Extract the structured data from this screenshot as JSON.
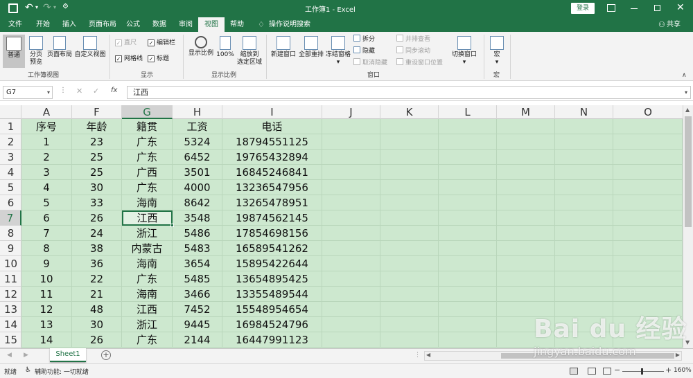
{
  "titlebar": {
    "save_icon": "save-icon",
    "title": "工作簿1  -  Excel",
    "login": "登录"
  },
  "menu": [
    "文件",
    "开始",
    "插入",
    "页面布局",
    "公式",
    "数据",
    "审阅",
    "视图",
    "帮助"
  ],
  "tell_me": "操作说明搜索",
  "share": "共享",
  "ribbon": {
    "views": {
      "normal": "普通",
      "page_break": "分页",
      "page_break2": "预览",
      "page_layout": "页面布局",
      "custom": "自定义视图",
      "group": "工作簿视图"
    },
    "show": {
      "ruler": "直尺",
      "formula_bar": "编辑栏",
      "gridlines": "网格线",
      "headings": "标题",
      "group": "显示"
    },
    "zoom": {
      "zoom": "显示比例",
      "hundred": "100%",
      "to_sel": "缩放到",
      "to_sel2": "选定区域",
      "group": "显示比例"
    },
    "window": {
      "new": "新建窗口",
      "arrange": "全部重排",
      "freeze": "冻结窗格",
      "split": "拆分",
      "hide": "隐藏",
      "unhide": "取消隐藏",
      "side": "并排查看",
      "sync": "同步滚动",
      "reset": "重设窗口位置",
      "switch": "切换窗口",
      "group": "窗口"
    },
    "macros": {
      "label": "宏",
      "group": "宏"
    }
  },
  "formula": {
    "name_box": "G7",
    "fx": "fx",
    "value": "江西"
  },
  "columns": [
    "A",
    "F",
    "G",
    "H",
    "I",
    "J",
    "K",
    "L",
    "M",
    "N",
    "O"
  ],
  "rows": [
    "1",
    "2",
    "3",
    "4",
    "5",
    "6",
    "7",
    "8",
    "9",
    "10",
    "11",
    "12",
    "13",
    "14",
    "15"
  ],
  "table": [
    [
      "序号",
      "年龄",
      "籍贯",
      "工资",
      "电话"
    ],
    [
      "1",
      "23",
      "广东",
      "5324",
      "18794551125"
    ],
    [
      "2",
      "25",
      "广东",
      "6452",
      "19765432894"
    ],
    [
      "3",
      "25",
      "广西",
      "3501",
      "16845246841"
    ],
    [
      "4",
      "30",
      "广东",
      "4000",
      "13236547956"
    ],
    [
      "5",
      "33",
      "海南",
      "8642",
      "13265478951"
    ],
    [
      "6",
      "26",
      "江西",
      "3548",
      "19874562145"
    ],
    [
      "7",
      "24",
      "浙江",
      "5486",
      "17854698156"
    ],
    [
      "8",
      "38",
      "内蒙古",
      "5483",
      "16589541262"
    ],
    [
      "9",
      "36",
      "海南",
      "3654",
      "15895422644"
    ],
    [
      "10",
      "22",
      "广东",
      "5485",
      "13654895425"
    ],
    [
      "11",
      "21",
      "海南",
      "3466",
      "13355489544"
    ],
    [
      "12",
      "48",
      "江西",
      "7452",
      "15548954654"
    ],
    [
      "13",
      "30",
      "浙江",
      "9445",
      "16984524796"
    ],
    [
      "14",
      "26",
      "广东",
      "2144",
      "16447991123"
    ]
  ],
  "sheet": {
    "tab": "Sheet1",
    "add": "+"
  },
  "status": {
    "ready": "就绪",
    "accessibility": "辅助功能: 一切就绪",
    "zoom": "160%"
  },
  "watermark": {
    "brand": "Bai du 经验",
    "url": "jingyan.baidu.com"
  }
}
